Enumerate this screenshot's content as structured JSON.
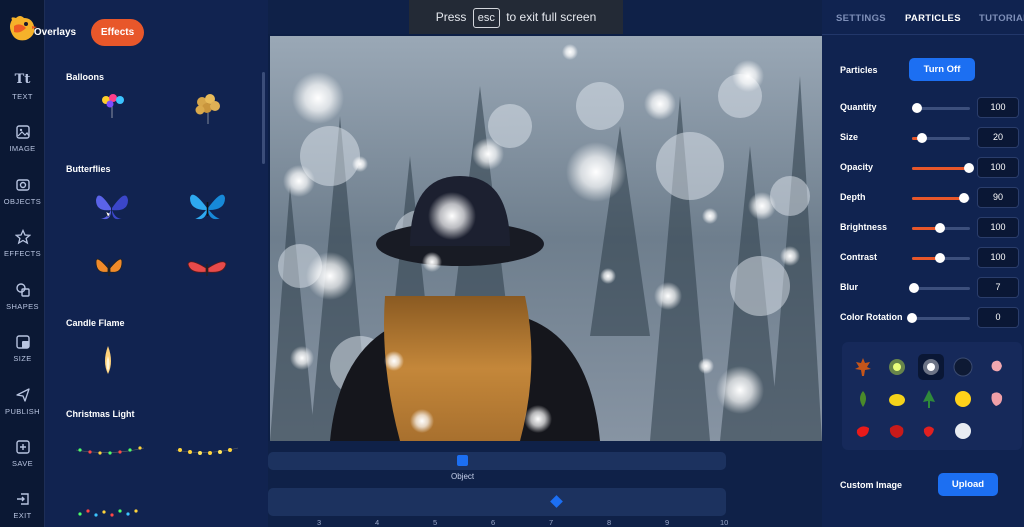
{
  "banner": {
    "pre": "Press",
    "key": "esc",
    "post": "to exit full screen"
  },
  "rail": [
    {
      "label": "TEXT",
      "icon": "text-icon"
    },
    {
      "label": "IMAGE",
      "icon": "image-icon"
    },
    {
      "label": "OBJECTS",
      "icon": "objects-icon"
    },
    {
      "label": "EFFECTS",
      "icon": "star-icon"
    },
    {
      "label": "SHAPES",
      "icon": "shapes-icon"
    },
    {
      "label": "SIZE",
      "icon": "size-icon"
    },
    {
      "label": "PUBLISH",
      "icon": "send-icon"
    },
    {
      "label": "SAVE",
      "icon": "save-icon"
    },
    {
      "label": "EXIT",
      "icon": "exit-icon"
    }
  ],
  "rail_text_glyph": "Tt",
  "panel": {
    "tabs": {
      "overlays": "Overlays",
      "effects": "Effects"
    },
    "categories": [
      "Balloons",
      "Butterflies",
      "Candle Flame",
      "Christmas Light"
    ]
  },
  "timeline": {
    "object_label": "Object",
    "ticks": [
      "3",
      "4",
      "5",
      "6",
      "7",
      "8",
      "9",
      "10"
    ]
  },
  "right": {
    "tabs": {
      "settings": "SETTINGS",
      "particles": "PARTICLES",
      "tutorial": "TUTORIAL"
    },
    "particles_label": "Particles",
    "turn_off": "Turn Off",
    "sliders": [
      {
        "label": "Quantity",
        "value": "100",
        "fraction": 0.08
      },
      {
        "label": "Size",
        "value": "20",
        "fraction": 0.18
      },
      {
        "label": "Opacity",
        "value": "100",
        "fraction": 0.98
      },
      {
        "label": "Depth",
        "value": "90",
        "fraction": 0.9
      },
      {
        "label": "Brightness",
        "value": "100",
        "fraction": 0.48
      },
      {
        "label": "Contrast",
        "value": "100",
        "fraction": 0.48
      },
      {
        "label": "Blur",
        "value": "7",
        "fraction": 0.03
      },
      {
        "label": "Color Rotation",
        "value": "0",
        "fraction": 0.0
      }
    ],
    "custom_image": "Custom Image",
    "upload": "Upload"
  },
  "colors": {
    "accent": "#e8572a",
    "blue": "#1c6ff2",
    "bg": "#0f2148"
  }
}
